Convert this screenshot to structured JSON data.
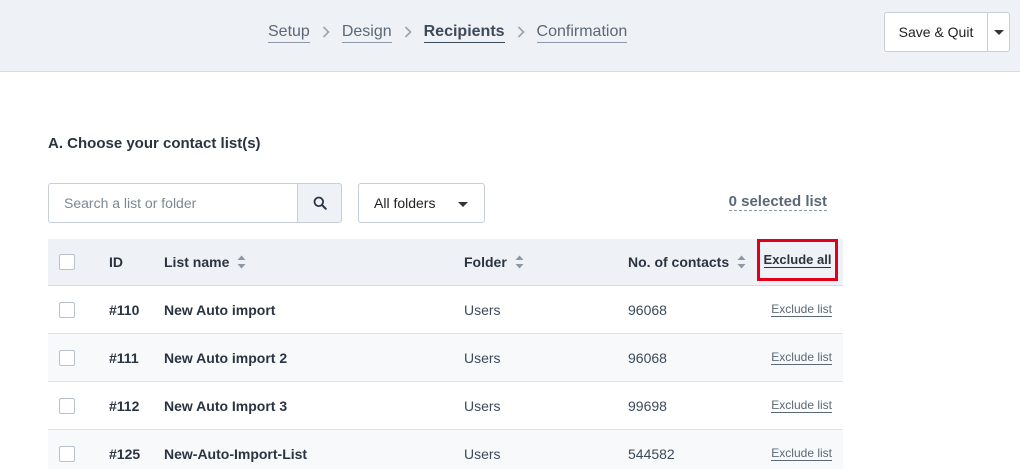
{
  "header": {
    "steps": [
      {
        "label": "Setup",
        "active": false
      },
      {
        "label": "Design",
        "active": false
      },
      {
        "label": "Recipients",
        "active": true
      },
      {
        "label": "Confirmation",
        "active": false
      }
    ],
    "save_label": "Save & Quit"
  },
  "section": {
    "title": "A. Choose your contact list(s)"
  },
  "search": {
    "placeholder": "Search a list or folder",
    "value": ""
  },
  "filter": {
    "folder_selected": "All folders"
  },
  "selection": {
    "count_label": "0 selected list"
  },
  "table": {
    "headers": {
      "id": "ID",
      "name": "List name",
      "folder": "Folder",
      "count": "No. of contacts",
      "exclude_all": "Exclude all"
    },
    "rows": [
      {
        "id": "#110",
        "name": "New Auto import",
        "folder": "Users",
        "count": "96068",
        "action": "Exclude list"
      },
      {
        "id": "#111",
        "name": "New Auto import 2",
        "folder": "Users",
        "count": "96068",
        "action": "Exclude list"
      },
      {
        "id": "#112",
        "name": "New Auto Import 3",
        "folder": "Users",
        "count": "99698",
        "action": "Exclude list"
      },
      {
        "id": "#125",
        "name": "New-Auto-Import-List",
        "folder": "Users",
        "count": "544582",
        "action": "Exclude list"
      }
    ]
  },
  "icons": {
    "step_separator": "chevron-right-icon",
    "search": "search-icon",
    "dropdown": "caret-down-icon",
    "sort": "sort-icon"
  },
  "colors": {
    "highlight": "#e0001b",
    "header_bg": "#eef1f5"
  }
}
